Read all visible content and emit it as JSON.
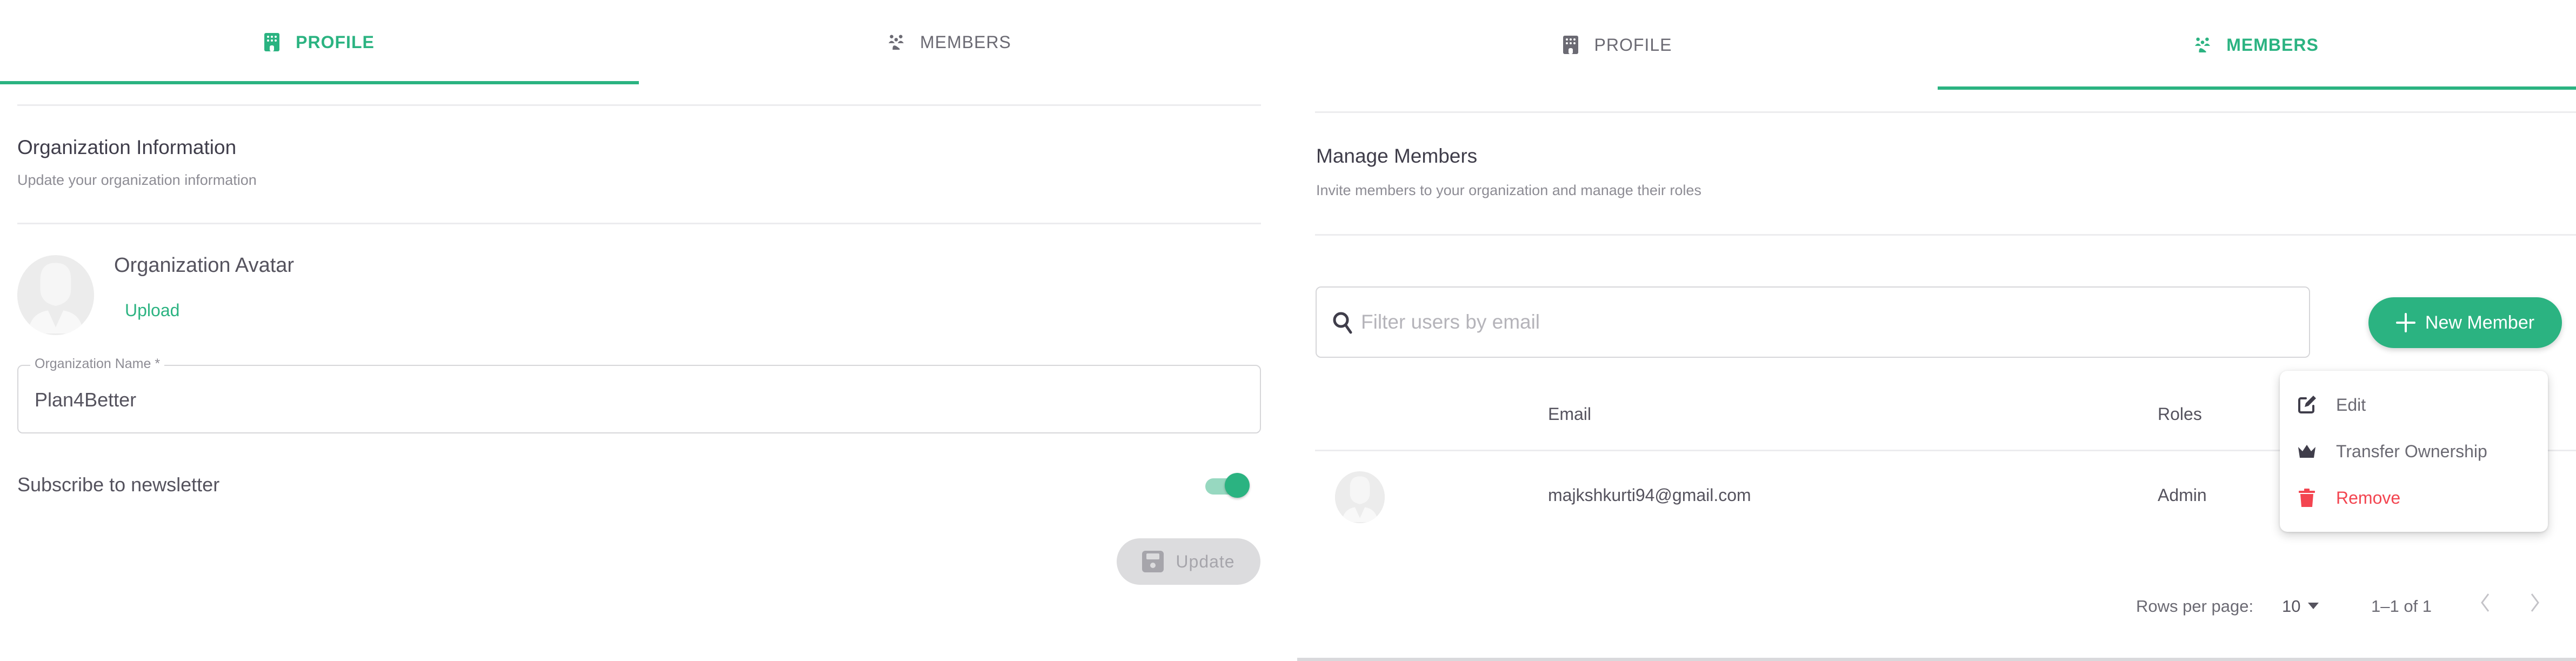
{
  "left_panel": {
    "tabs": [
      {
        "label": "PROFILE",
        "icon": "building-icon",
        "active": true
      },
      {
        "label": "MEMBERS",
        "icon": "users-icon",
        "active": false
      }
    ],
    "section": {
      "title": "Organization Information",
      "subtitle": "Update your organization information"
    },
    "avatar": {
      "label": "Organization Avatar",
      "upload_label": "Upload"
    },
    "org_name_field": {
      "label": "Organization Name *",
      "value": "Plan4Better"
    },
    "newsletter": {
      "label": "Subscribe to newsletter",
      "enabled": true
    },
    "update_button": {
      "label": "Update",
      "icon": "save-icon",
      "disabled": true
    }
  },
  "right_panel": {
    "tabs": [
      {
        "label": "PROFILE",
        "icon": "building-icon",
        "active": false
      },
      {
        "label": "MEMBERS",
        "icon": "users-icon",
        "active": true
      }
    ],
    "section": {
      "title": "Manage Members",
      "subtitle": "Invite members to your organization and manage their roles"
    },
    "search": {
      "placeholder": "Filter users by email",
      "value": ""
    },
    "new_member_button": {
      "label": "New Member",
      "icon": "plus-icon"
    },
    "table": {
      "columns": [
        "",
        "Email",
        "Roles"
      ],
      "rows": [
        {
          "email": "majkshkurti94@gmail.com",
          "role": "Admin"
        }
      ]
    },
    "context_menu": {
      "items": [
        {
          "label": "Edit",
          "icon": "edit-icon"
        },
        {
          "label": "Transfer Ownership",
          "icon": "crown-icon"
        },
        {
          "label": "Remove",
          "icon": "trash-icon",
          "danger": true
        }
      ]
    },
    "pagination": {
      "rows_per_page_label": "Rows per page:",
      "rows_per_page": "10",
      "range": "1–1 of 1"
    }
  },
  "colors": {
    "accent": "#2bb381",
    "danger": "#f34550",
    "text": "#3f3d4a",
    "muted": "#8d8c94"
  }
}
